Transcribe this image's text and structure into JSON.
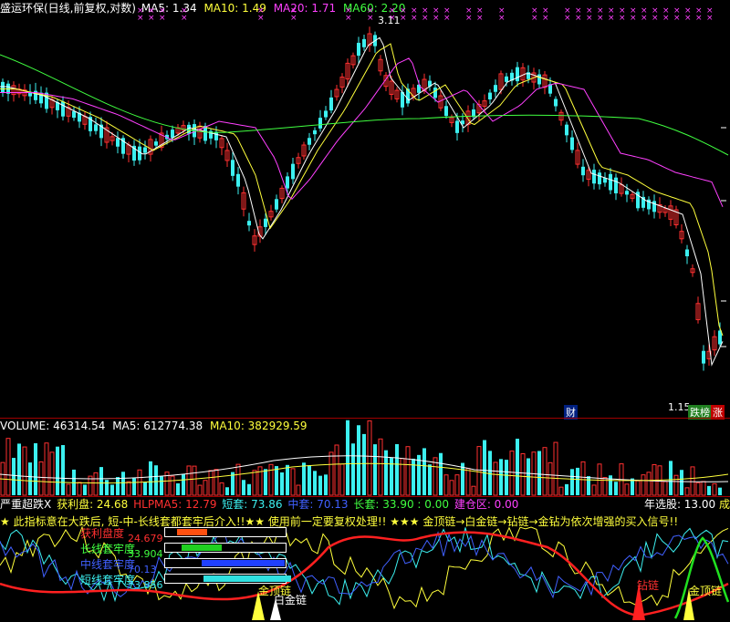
{
  "header": {
    "title": "盛运环保(日线,前复权,对数)",
    "ma5": "MA5: 1.34",
    "ma10": "MA10: 1.49",
    "ma20": "MA20: 1.71",
    "ma60": "MA60: 2.20"
  },
  "price_panel": {
    "high_label": "3.11",
    "low_label": "1.15",
    "badge_cai": "财",
    "badge_die": "跌榜",
    "badge_zhang": "涨"
  },
  "volume_panel": {
    "volume": "VOLUME: 46314.54",
    "ma5": "MA5: 612774.38",
    "ma10": "MA10: 382929.59"
  },
  "indicator_panel": {
    "name": "严重超跌X",
    "profit": "获利盘: 24.68",
    "hlpma5": "HLPMA5: 12.79",
    "short": "短套: 73.86",
    "mid": "中套: 70.13",
    "long": "长套: 33.90 : 0.00",
    "build": "建仓区: 0.00",
    "year_pick": "年选股: 13.00",
    "year_pick_suffix": "成",
    "notice": "★ 此指标意在大跌后, 短-中-长线套都套牢后介入!!★★ 使用前一定要复权处理!! ★★★ 金顶链→白金链→钻链→金钻为依次增强的买入信号!!",
    "rows": [
      {
        "label": "获利盘度",
        "value": "24.679",
        "fill": 0.25,
        "color": "#ff5010"
      },
      {
        "label": "长线套牢度",
        "value": "33.904",
        "fill": 0.34,
        "color": "#20d020"
      },
      {
        "label": "中线套牢度",
        "value": "70.13",
        "fill": 0.7,
        "color": "#2040ff"
      },
      {
        "label": "短线套牢度",
        "value": "73.856",
        "fill": 0.74,
        "color": "#30e0e0"
      }
    ],
    "signal_gold_top": "金顶链",
    "signal_white_gold": "白金链",
    "signal_diamond": "钻链",
    "signal_gold_top2": "金顶链"
  },
  "colors": {
    "up": "#ff3030",
    "down": "#3cf0f0",
    "ma5": "#ffffff",
    "ma10": "#ffff3c",
    "ma20": "#ff40ff",
    "ma60": "#40ff40",
    "separator": "#a00000"
  }
}
